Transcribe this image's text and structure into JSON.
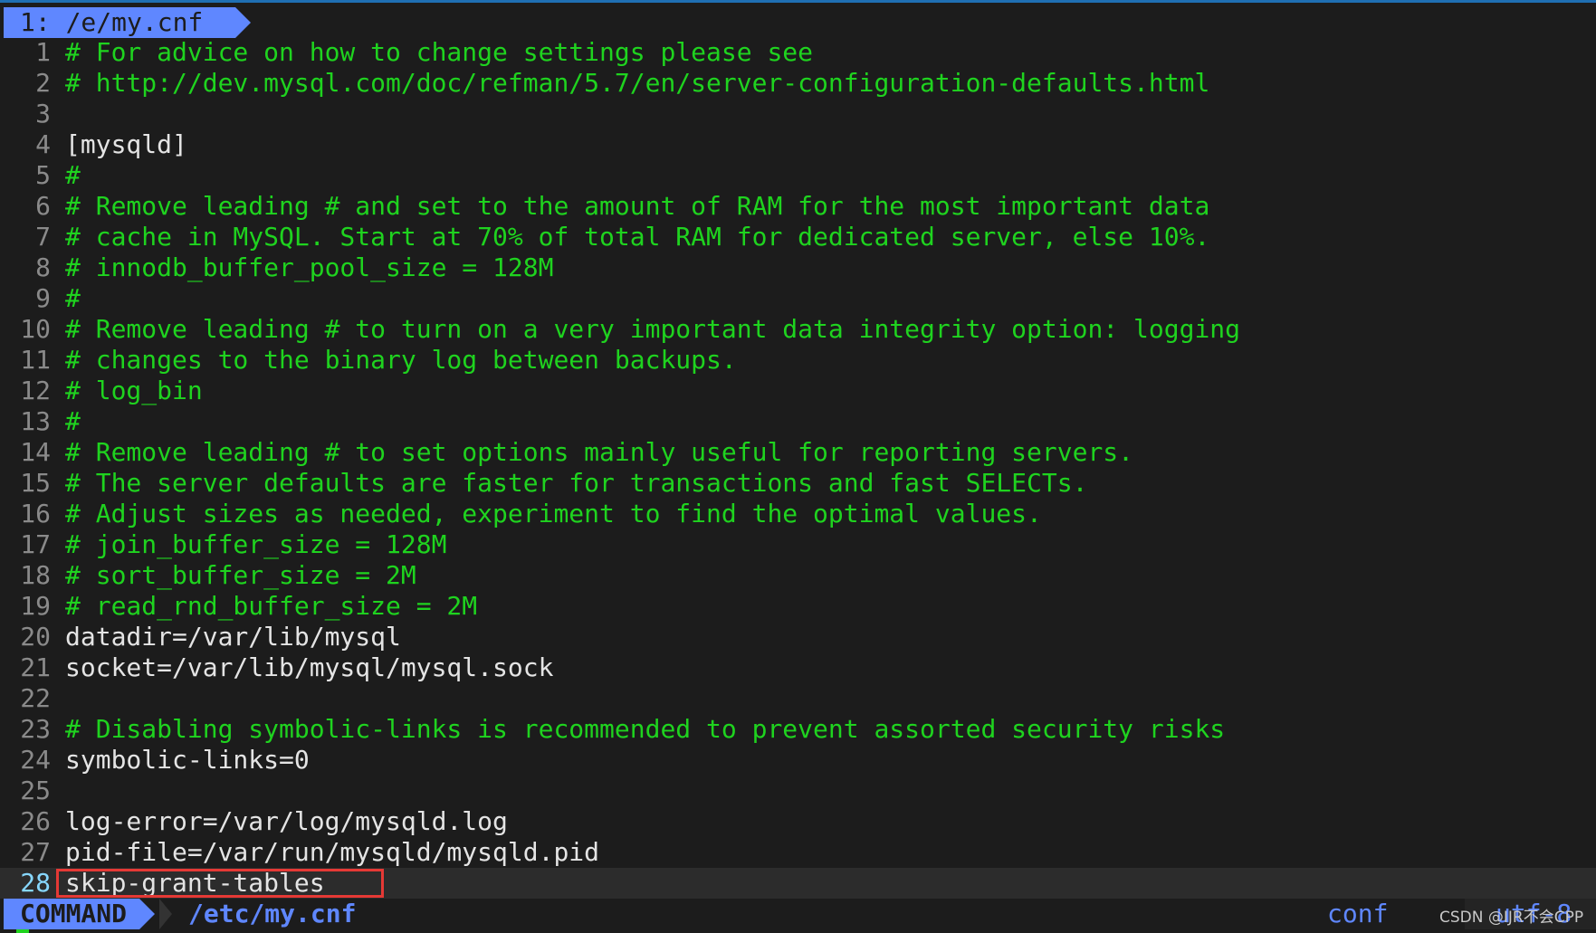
{
  "tab": {
    "label": "1: /e/my.cnf"
  },
  "lines": [
    {
      "n": "1",
      "text": "# For advice on how to change settings please see",
      "comment": true
    },
    {
      "n": "2",
      "text": "# http://dev.mysql.com/doc/refman/5.7/en/server-configuration-defaults.html",
      "comment": true
    },
    {
      "n": "3",
      "text": "",
      "comment": false
    },
    {
      "n": "4",
      "text": "[mysqld]",
      "comment": false
    },
    {
      "n": "5",
      "text": "#",
      "comment": true
    },
    {
      "n": "6",
      "text": "# Remove leading # and set to the amount of RAM for the most important data",
      "comment": true
    },
    {
      "n": "7",
      "text": "# cache in MySQL. Start at 70% of total RAM for dedicated server, else 10%.",
      "comment": true
    },
    {
      "n": "8",
      "text": "# innodb_buffer_pool_size = 128M",
      "comment": true
    },
    {
      "n": "9",
      "text": "#",
      "comment": true
    },
    {
      "n": "10",
      "text": "# Remove leading # to turn on a very important data integrity option: logging",
      "comment": true
    },
    {
      "n": "11",
      "text": "# changes to the binary log between backups.",
      "comment": true
    },
    {
      "n": "12",
      "text": "# log_bin",
      "comment": true
    },
    {
      "n": "13",
      "text": "#",
      "comment": true
    },
    {
      "n": "14",
      "text": "# Remove leading # to set options mainly useful for reporting servers.",
      "comment": true
    },
    {
      "n": "15",
      "text": "# The server defaults are faster for transactions and fast SELECTs.",
      "comment": true
    },
    {
      "n": "16",
      "text": "# Adjust sizes as needed, experiment to find the optimal values.",
      "comment": true
    },
    {
      "n": "17",
      "text": "# join_buffer_size = 128M",
      "comment": true
    },
    {
      "n": "18",
      "text": "# sort_buffer_size = 2M",
      "comment": true
    },
    {
      "n": "19",
      "text": "# read_rnd_buffer_size = 2M",
      "comment": true
    },
    {
      "n": "20",
      "text": "datadir=/var/lib/mysql",
      "comment": false
    },
    {
      "n": "21",
      "text": "socket=/var/lib/mysql/mysql.sock",
      "comment": false
    },
    {
      "n": "22",
      "text": "",
      "comment": false
    },
    {
      "n": "23",
      "text": "# Disabling symbolic-links is recommended to prevent assorted security risks",
      "comment": true
    },
    {
      "n": "24",
      "text": "symbolic-links=0",
      "comment": false
    },
    {
      "n": "25",
      "text": "",
      "comment": false
    },
    {
      "n": "26",
      "text": "log-error=/var/log/mysqld.log",
      "comment": false
    },
    {
      "n": "27",
      "text": "pid-file=/var/run/mysqld/mysqld.pid",
      "comment": false
    },
    {
      "n": "28",
      "text": "skip-grant-tables",
      "comment": false,
      "current": true,
      "highlighted": true
    }
  ],
  "status": {
    "mode": "COMMAND",
    "file": "/etc/my.cnf",
    "filetype": "conf",
    "encoding": "utf-8"
  },
  "watermark": "CSDN @IJR不会CPP",
  "colors": {
    "accent": "#5f87ff",
    "comment": "#1fd31f",
    "text": "#e4e4e4",
    "background": "#1c1c1c",
    "highlight_box": "#e53935"
  }
}
